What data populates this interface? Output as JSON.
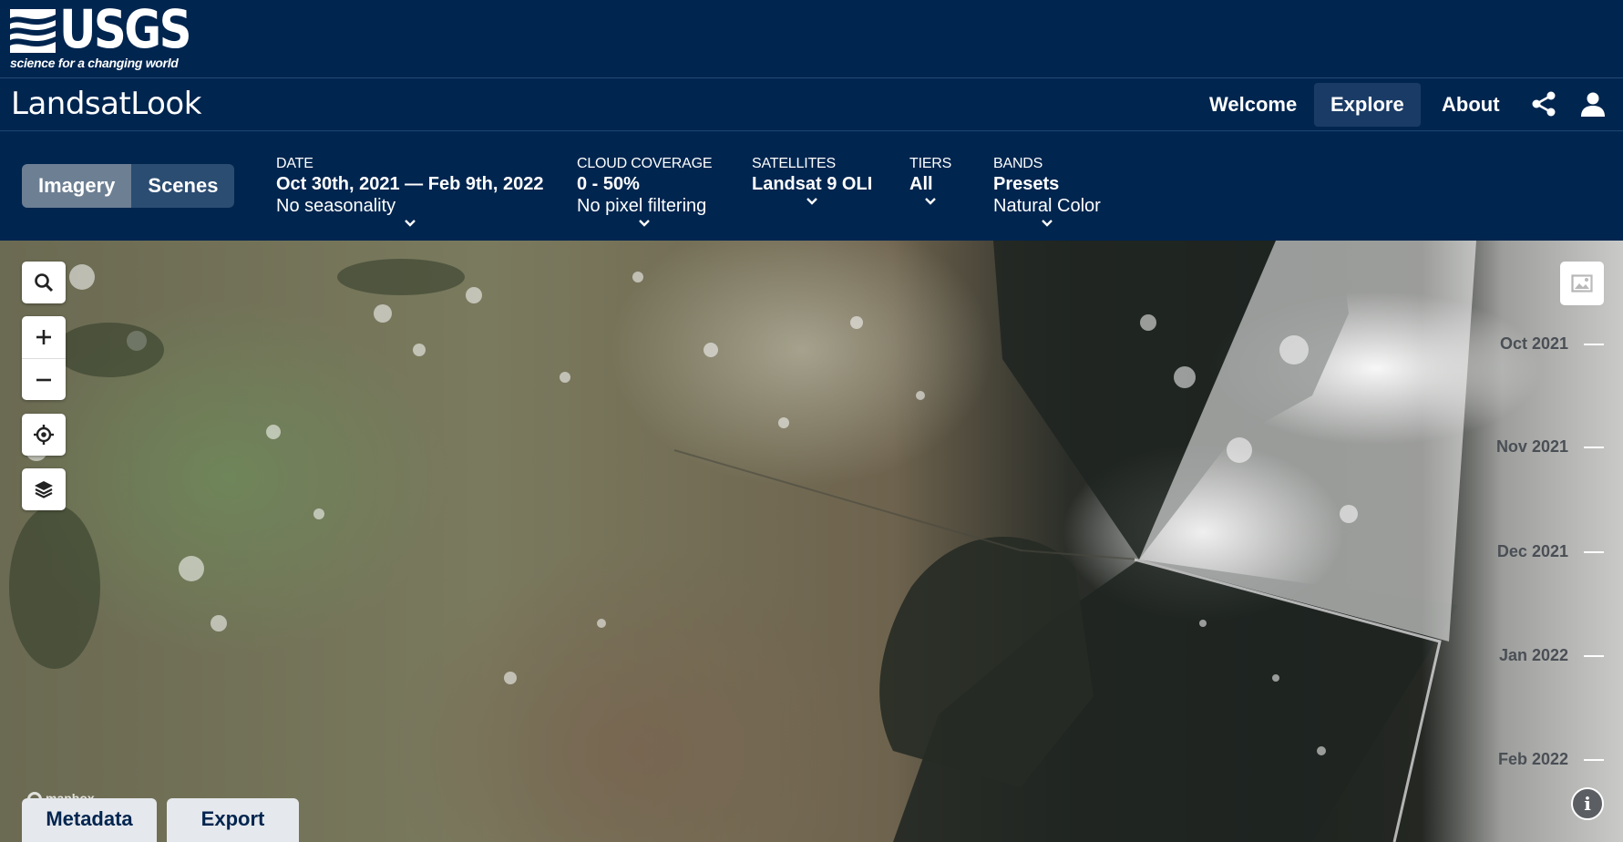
{
  "brand": {
    "logo_word": "USGS",
    "tagline": "science for a changing world"
  },
  "header": {
    "app_title": "LandsatLook",
    "nav": {
      "welcome": "Welcome",
      "explore": "Explore",
      "about": "About"
    },
    "icons": [
      "share-icon",
      "user-icon"
    ]
  },
  "filters": {
    "mode_tabs": {
      "imagery": "Imagery",
      "scenes": "Scenes",
      "active": "Imagery"
    },
    "date": {
      "label": "DATE",
      "value": "Oct 30th, 2021 — Feb 9th, 2022",
      "sub": "No seasonality"
    },
    "cloud": {
      "label": "CLOUD COVERAGE",
      "value": "0 - 50%",
      "sub": "No pixel filtering"
    },
    "satellites": {
      "label": "SATELLITES",
      "value": "Landsat 9 OLI"
    },
    "tiers": {
      "label": "TIERS",
      "value": "All"
    },
    "bands": {
      "label": "BANDS",
      "value": "Presets",
      "sub": "Natural Color"
    }
  },
  "map": {
    "controls": [
      "search-icon",
      "zoom-in-icon",
      "zoom-out-icon",
      "locate-icon",
      "layers-icon",
      "image-icon"
    ],
    "timeline": [
      "Oct 2021",
      "Nov 2021",
      "Dec 2021",
      "Jan 2022",
      "Feb 2022"
    ],
    "info_glyph": "i",
    "attribution": "mapbox"
  },
  "bottom_tabs": {
    "metadata": "Metadata",
    "export": "Export"
  },
  "colors": {
    "header_bg": "#00254f",
    "active_tab": "#6d7f93",
    "inactive_tab": "#2c4d72"
  }
}
